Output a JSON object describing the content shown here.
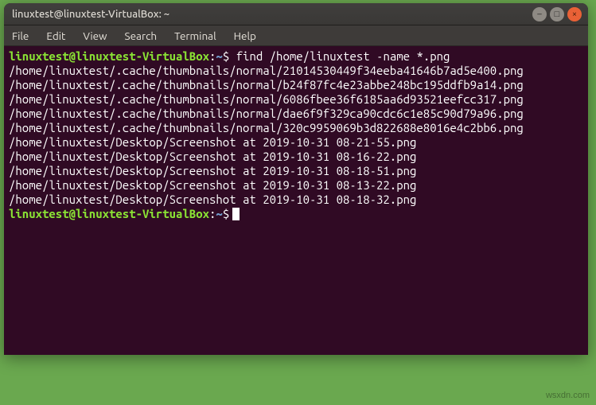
{
  "titlebar": {
    "title": "linuxtest@linuxtest-VirtualBox: ~",
    "min": "–",
    "max": "□",
    "close": "×"
  },
  "menu": {
    "file": "File",
    "edit": "Edit",
    "view": "View",
    "search": "Search",
    "terminal": "Terminal",
    "help": "Help"
  },
  "prompt": {
    "user_host": "linuxtest@linuxtest-VirtualBox",
    "sep1": ":",
    "cwd": "~",
    "sep2": "$"
  },
  "command": "find /home/linuxtest -name *.png",
  "output": [
    "/home/linuxtest/.cache/thumbnails/normal/21014530449f34eeba41646b7ad5e400.png",
    "/home/linuxtest/.cache/thumbnails/normal/b24f87fc4e23abbe248bc195ddfb9a14.png",
    "/home/linuxtest/.cache/thumbnails/normal/6086fbee36f6185aa6d93521eefcc317.png",
    "/home/linuxtest/.cache/thumbnails/normal/dae6f9f329ca90cdc6c1e85c90d79a96.png",
    "/home/linuxtest/.cache/thumbnails/normal/320c9959069b3d822688e8016e4c2bb6.png",
    "/home/linuxtest/Desktop/Screenshot at 2019-10-31 08-21-55.png",
    "/home/linuxtest/Desktop/Screenshot at 2019-10-31 08-16-22.png",
    "/home/linuxtest/Desktop/Screenshot at 2019-10-31 08-18-51.png",
    "/home/linuxtest/Desktop/Screenshot at 2019-10-31 08-13-22.png",
    "/home/linuxtest/Desktop/Screenshot at 2019-10-31 08-18-32.png"
  ],
  "watermark": "wsxdn.com"
}
